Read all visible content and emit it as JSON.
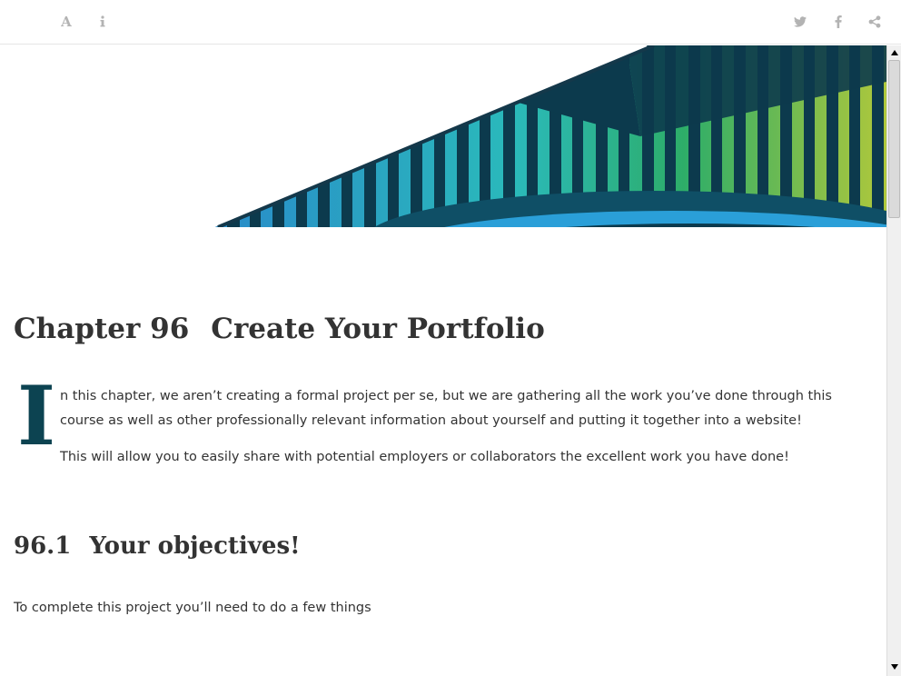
{
  "toolbar": {
    "left_icons": [
      "font-settings-icon",
      "info-icon"
    ],
    "font_glyph": "A",
    "right_icons": [
      "twitter-icon",
      "facebook-icon",
      "share-icon"
    ],
    "icon_color": "#b3b3b3"
  },
  "banner": {
    "description_icon": "abstract-blue-green-bridge-banner",
    "accent": "#0c4351"
  },
  "chapter": {
    "number": "Chapter 96",
    "title": "Create Your Portfolio",
    "drop_cap": "I",
    "paragraphs": [
      "n this chapter, we aren’t creating a formal project per se, but we are gathering all the work you’ve done through this course as well as other professionally relevant information about yourself and putting it together into a website!",
      "This will allow you to easily share with potential employers or collaborators the excellent work you have done!"
    ]
  },
  "section": {
    "number": "96.1",
    "title": "Your objectives!",
    "intro": "To complete this project you’ll need to do a few things"
  },
  "scrollbar": {
    "up_arrow": "▲",
    "down_arrow": "▼"
  }
}
